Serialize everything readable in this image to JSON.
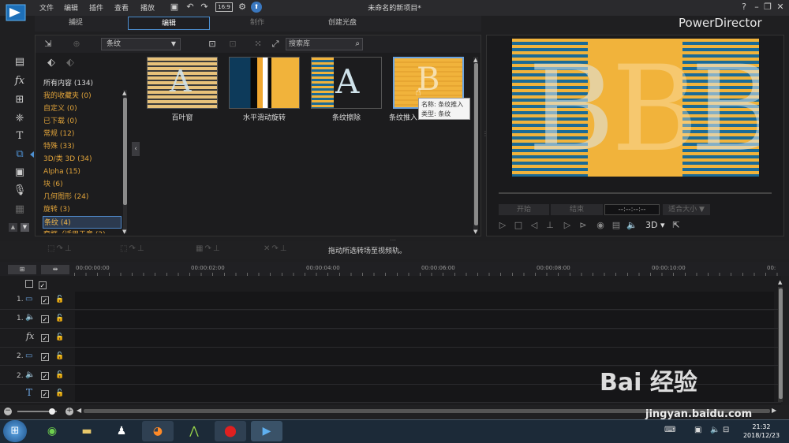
{
  "menu": [
    "文件",
    "编辑",
    "插件",
    "查看",
    "播放"
  ],
  "title": "未命名的新项目*",
  "brand": "PowerDirector",
  "ratio": "16:9",
  "modes": [
    "捕捉",
    "编辑",
    "制作",
    "创建光盘"
  ],
  "library": {
    "category_selected": "条纹",
    "search_placeholder": "搜索库",
    "categories": [
      "所有内容 (134)",
      "我的收藏夹 (0)",
      "自定义 (0)",
      "已下载 (0)",
      "常规 (12)",
      "特殊 (33)",
      "3D/类 3D (34)",
      "Alpha (15)",
      "块 (6)",
      "几何图形 (24)",
      "旋转 (3)",
      "条纹 (4)",
      "套框（适用于意 (2)"
    ],
    "items": [
      "百叶窗",
      "水平滑动旋转",
      "条纹擦除",
      "条纹推入"
    ],
    "tooltip_name": "名称: 条纹推入",
    "tooltip_type": "类型: 条纹"
  },
  "preview": {
    "btn_start": "开始",
    "btn_end": "结束",
    "timecode": "--:--:--:--",
    "fit": "适合大小",
    "mode3d": "3D"
  },
  "hint": "拖动所选转场至视频轨。",
  "timeline": {
    "ticks": [
      "00:00:00:00",
      "00:00:02:00",
      "00:00:04:00",
      "00:00:06:00",
      "00:00:08:00",
      "00:00:10:00",
      "00:"
    ],
    "tracks": [
      "",
      "1.",
      "1.",
      "",
      "2.",
      "2.",
      "",
      ""
    ]
  },
  "clock": {
    "time": "21:32",
    "date": "2018/12/23"
  },
  "watermark": {
    "main": "Bai 经验",
    "sub": "jingyan.baidu.com"
  },
  "colors": {
    "accent": "#4d8fd0",
    "category": "#e0a33a",
    "stripe_gold": "#f1b33b",
    "stripe_blue": "#1a6a96"
  }
}
